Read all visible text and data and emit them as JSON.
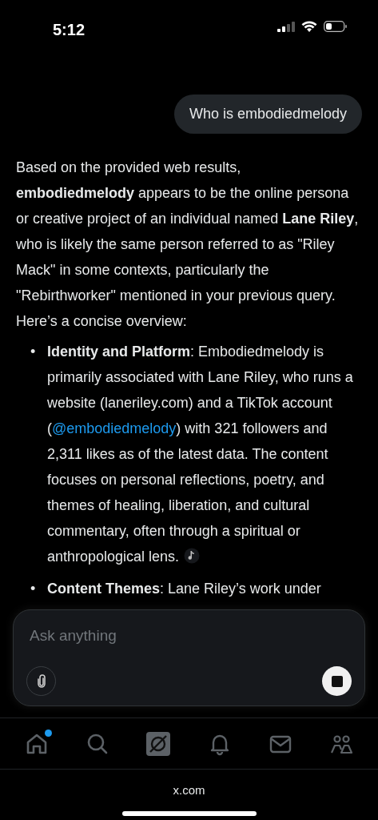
{
  "status_bar": {
    "time": "5:12"
  },
  "user_message": {
    "text": "Who is embodiedmelody"
  },
  "answer": {
    "intro": "Based on the provided web results, **embodiedmelody** appears to be the online persona or creative project of an individual named **Lane Riley**, who is likely the same person referred to as \"Riley Mack\" in some contexts, particularly the \"Rebirthworker\" mentioned in your previous query. Here’s a concise overview:",
    "bullets": [
      {
        "marker": "•",
        "parts": [
          {
            "kind": "text",
            "text": "**Identity and Platform**: Embodiedmelody is primarily associated with Lane Riley, who runs a website (laneriley.com) and a TikTok account ("
          },
          {
            "kind": "link",
            "text": "@embodiedmelody"
          },
          {
            "kind": "text",
            "text": ") with 321 followers and 2,311 likes as of the latest data. The content focuses on personal reflections, poetry, and themes of healing, liberation, and cultural commentary, often through a spiritual or anthropological lens."
          },
          {
            "kind": "source"
          }
        ]
      },
      {
        "marker": "•",
        "parts": [
          {
            "kind": "text",
            "text": "**Content Themes**: Lane Riley’s work under"
          }
        ]
      }
    ]
  },
  "composer": {
    "placeholder": "Ask anything"
  },
  "nav": [
    {
      "kind": "home",
      "selected": false,
      "dot": true
    },
    {
      "kind": "search",
      "selected": false,
      "dot": false
    },
    {
      "kind": "grok",
      "selected": true,
      "dot": false
    },
    {
      "kind": "bell",
      "selected": false,
      "dot": false
    },
    {
      "kind": "mail",
      "selected": false,
      "dot": false
    },
    {
      "kind": "people",
      "selected": false,
      "dot": false
    }
  ],
  "browser": {
    "url": "x.com"
  }
}
